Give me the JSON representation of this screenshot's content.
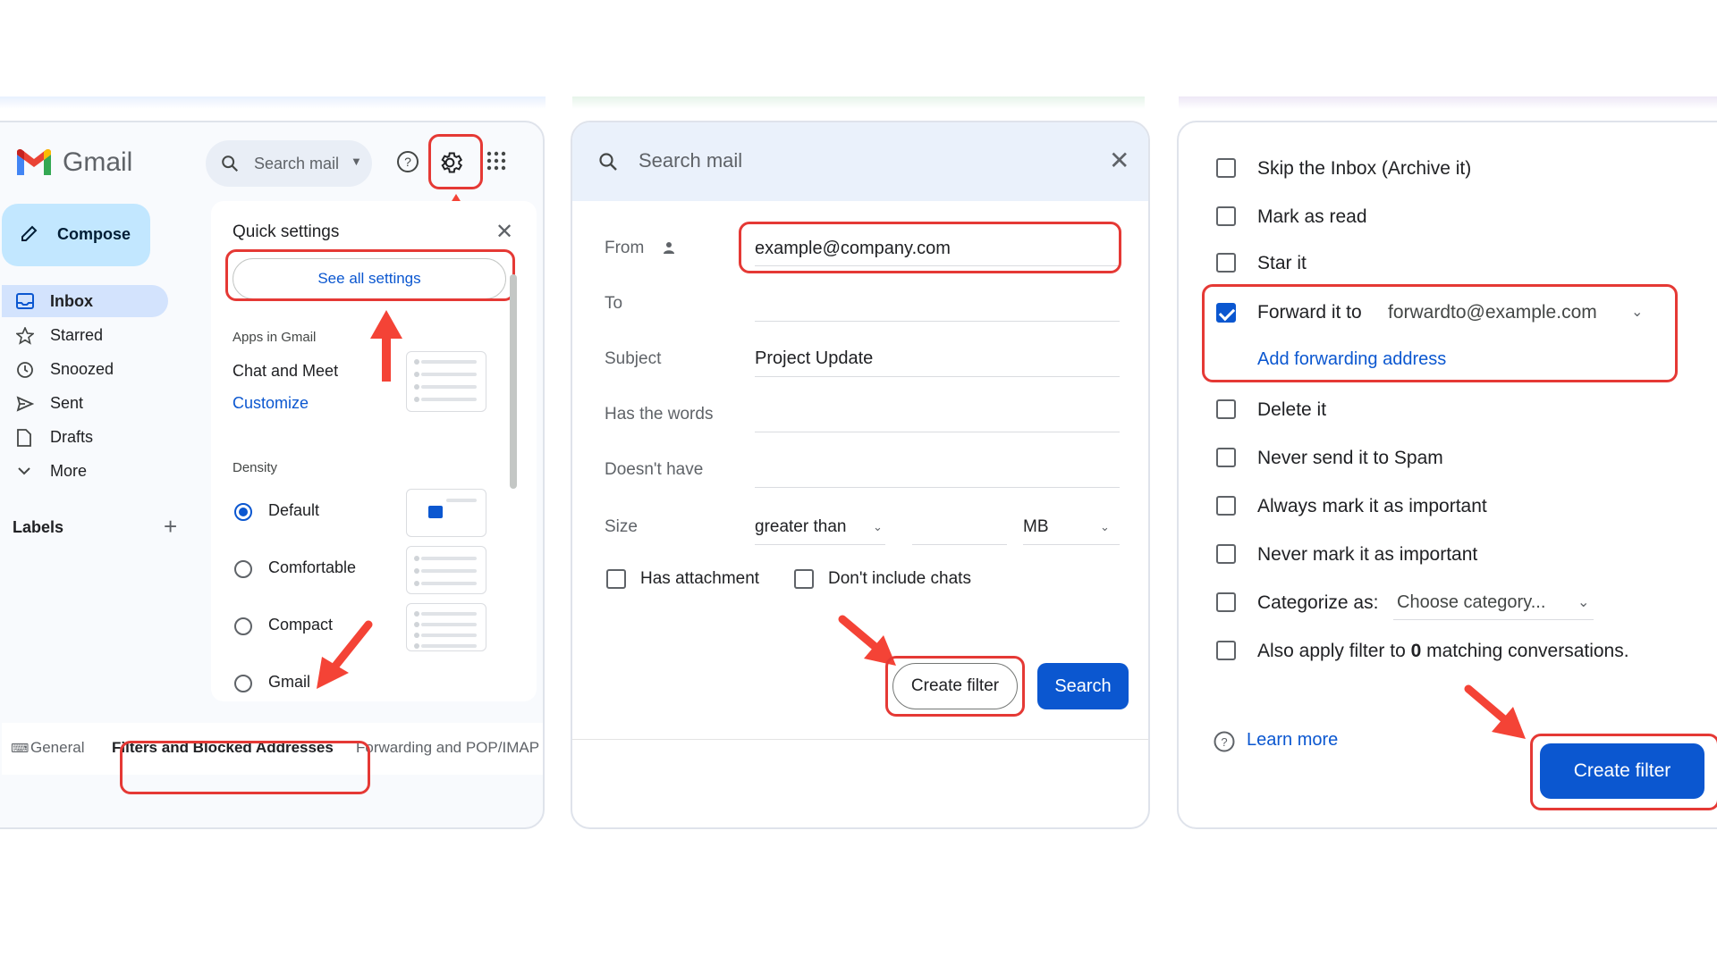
{
  "panel1": {
    "app_name": "Gmail",
    "search_placeholder": "Search mail",
    "compose_label": "Compose",
    "nav": [
      "Inbox",
      "Starred",
      "Snoozed",
      "Sent",
      "Drafts",
      "More"
    ],
    "labels_heading": "Labels",
    "quick_settings": {
      "title": "Quick settings",
      "see_all": "See all settings",
      "apps_heading": "Apps in Gmail",
      "chat_meet": "Chat and Meet",
      "customize": "Customize",
      "density_heading": "Density",
      "density_options": [
        "Default",
        "Comfortable",
        "Compact"
      ],
      "density_selected": "Default",
      "partial_option": "Gmail"
    },
    "settings_tabs": [
      "General",
      "Filters and Blocked Addresses",
      "Forwarding and POP/IMAP"
    ],
    "active_tab": "Filters and Blocked Addresses"
  },
  "panel2": {
    "search_placeholder": "Search mail",
    "fields": {
      "from_label": "From",
      "from_value": "example@company.com",
      "to_label": "To",
      "subject_label": "Subject",
      "subject_value": "Project Update",
      "has_words_label": "Has the words",
      "doesnt_have_label": "Doesn't have",
      "size_label": "Size",
      "size_operator": "greater than",
      "size_unit": "MB"
    },
    "checks": {
      "has_attachment": "Has attachment",
      "no_chats": "Don't include chats"
    },
    "create_filter": "Create filter",
    "search": "Search"
  },
  "panel3": {
    "options": {
      "skip_inbox": "Skip the Inbox (Archive it)",
      "mark_read": "Mark as read",
      "star": "Star it",
      "forward": "Forward it to",
      "forward_address": "forwardto@example.com",
      "add_forwarding": "Add forwarding address",
      "delete": "Delete it",
      "never_spam": "Never send it to Spam",
      "always_important": "Always mark it as important",
      "never_important": "Never mark it as important",
      "categorize": "Categorize as:",
      "category_placeholder": "Choose category...",
      "also_apply_pre": "Also apply filter to ",
      "also_apply_count": "0",
      "also_apply_post": " matching conversations."
    },
    "forward_checked": true,
    "learn_more": "Learn more",
    "create_filter": "Create filter"
  },
  "colors": {
    "highlight": "#e53935",
    "arrow": "#f44336",
    "primary_blue": "#0b57d0"
  }
}
